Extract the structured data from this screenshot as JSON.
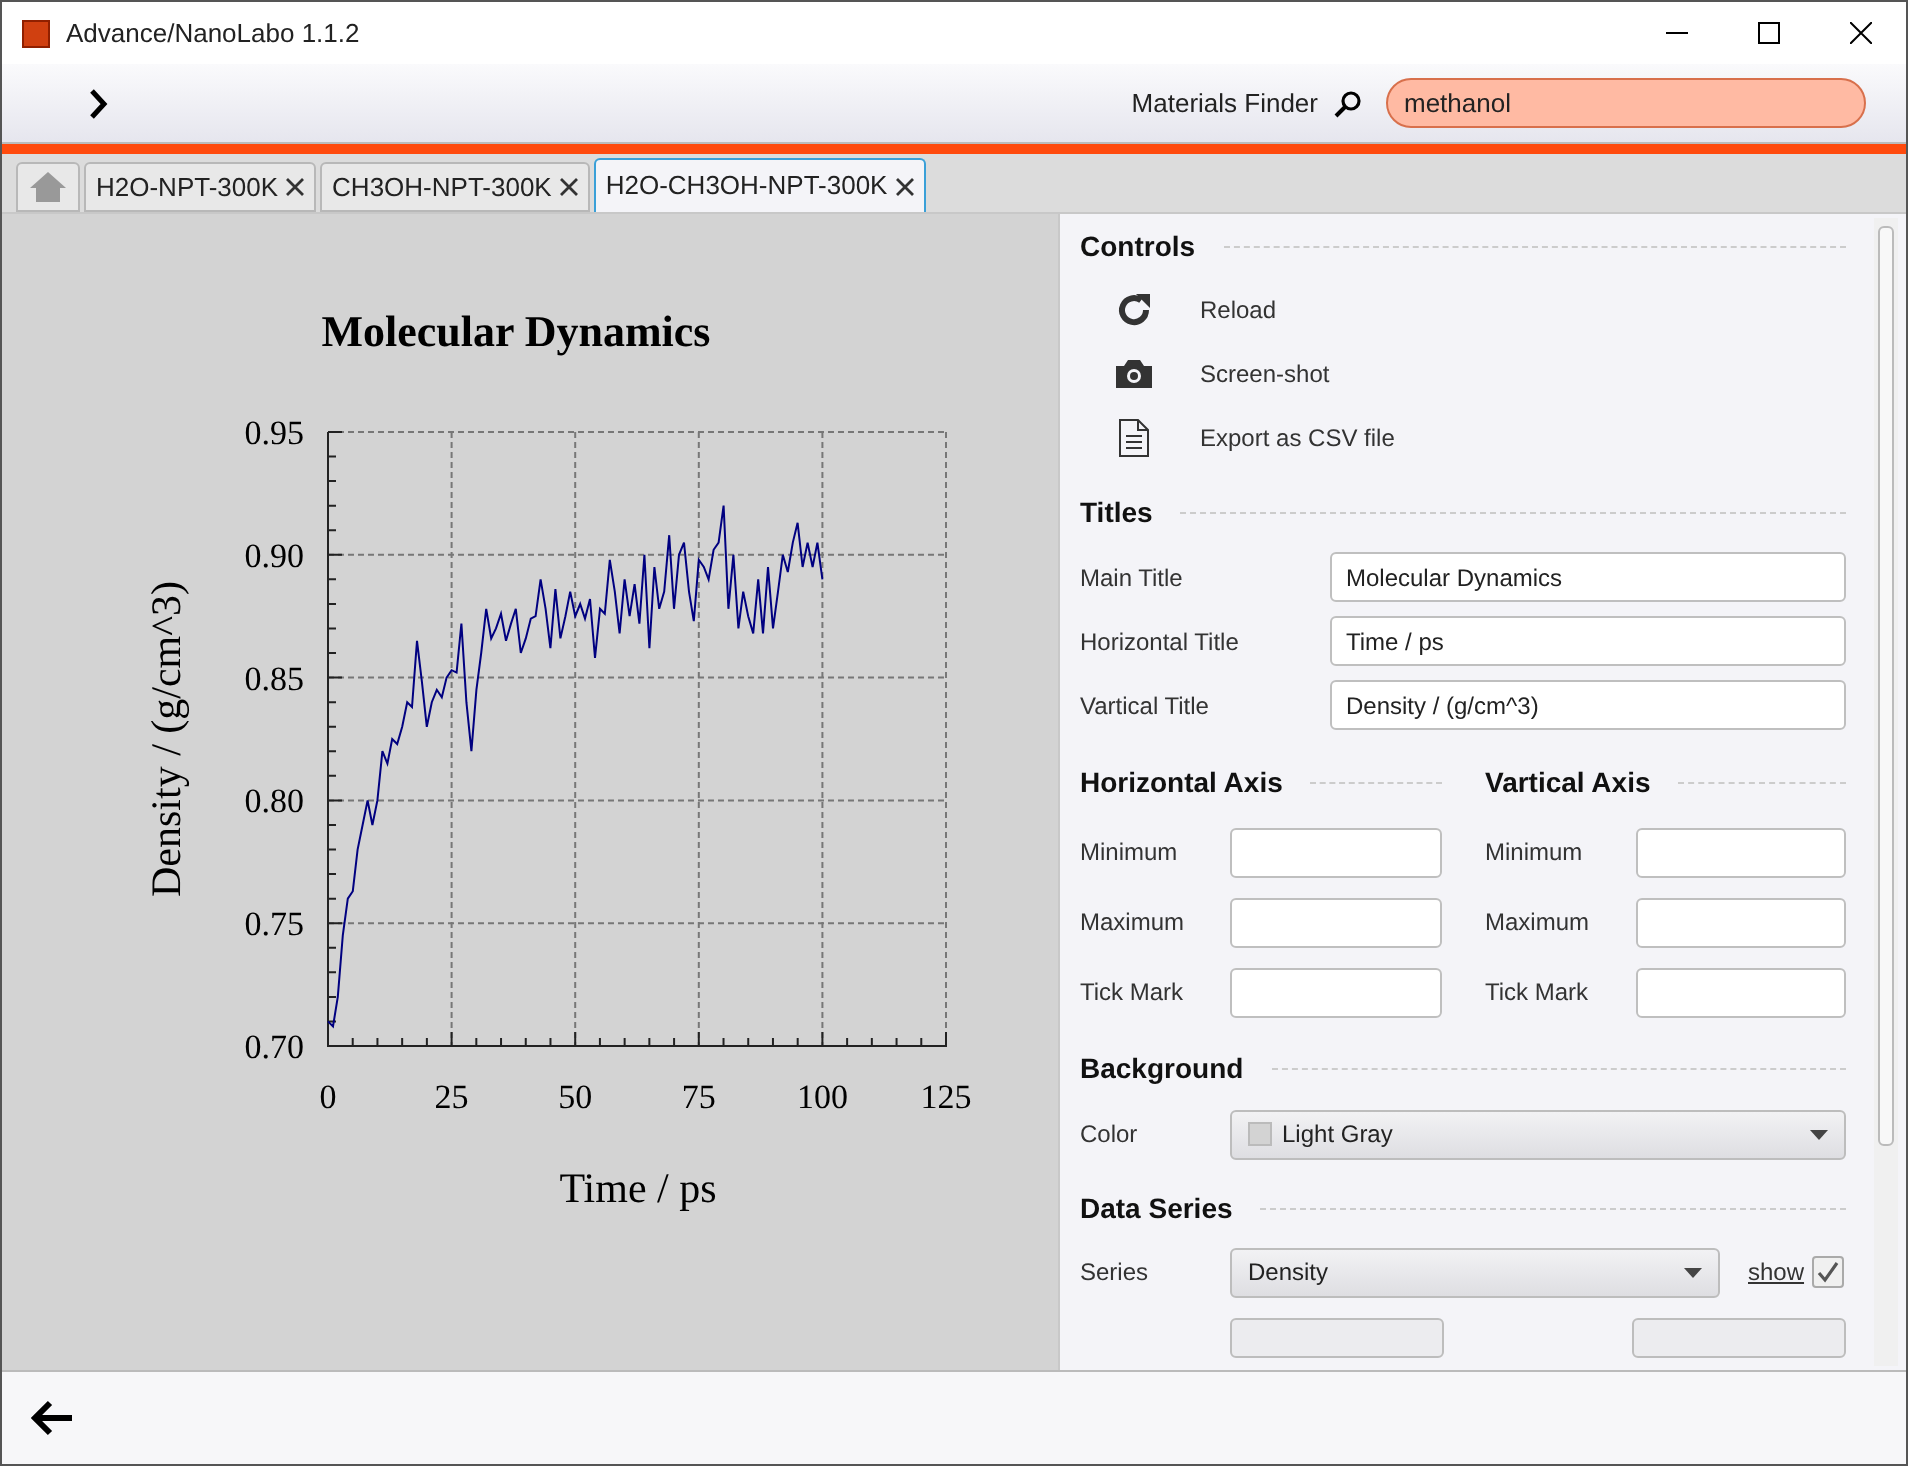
{
  "window": {
    "title": "Advance/NanoLabo 1.1.2"
  },
  "toolbar": {
    "finder_label": "Materials Finder",
    "search": {
      "value": "methanol"
    }
  },
  "tabs": [
    {
      "kind": "home",
      "selected": false
    },
    {
      "kind": "document",
      "label": "H2O-NPT-300K",
      "selected": false
    },
    {
      "kind": "document",
      "label": "CH3OH-NPT-300K",
      "selected": false
    },
    {
      "kind": "document",
      "label": "H2O-CH3OH-NPT-300K",
      "selected": true
    }
  ],
  "chart": {
    "chart_data": {
      "type": "line",
      "grid": true,
      "title": "Molecular Dynamics",
      "xlabel": "Time / ps",
      "ylabel": "Density / (g/cm^3)",
      "xlim": [
        0,
        125
      ],
      "ylim": [
        0.7,
        0.95
      ],
      "xticks": [
        0,
        25,
        50,
        75,
        100,
        125
      ],
      "yticks": [
        {
          "value": 0.7,
          "label": "0.70"
        },
        {
          "value": 0.75,
          "label": "0.75"
        },
        {
          "value": 0.8,
          "label": "0.80"
        },
        {
          "value": 0.85,
          "label": "0.85"
        },
        {
          "value": 0.9,
          "label": "0.90"
        },
        {
          "value": 0.95,
          "label": "0.95"
        }
      ],
      "x": [
        0,
        1,
        2,
        3,
        4,
        5,
        6,
        7,
        8,
        9,
        10,
        11,
        12,
        13,
        14,
        15,
        16,
        17,
        18,
        19,
        20,
        21,
        22,
        23,
        24,
        25,
        26,
        27,
        28,
        29,
        30,
        31,
        32,
        33,
        34,
        35,
        36,
        37,
        38,
        39,
        40,
        41,
        42,
        43,
        44,
        45,
        46,
        47,
        48,
        49,
        50,
        51,
        52,
        53,
        54,
        55,
        56,
        57,
        58,
        59,
        60,
        61,
        62,
        63,
        64,
        65,
        66,
        67,
        68,
        69,
        70,
        71,
        72,
        73,
        74,
        75,
        76,
        77,
        78,
        79,
        80,
        81,
        82,
        83,
        84,
        85,
        86,
        87,
        88,
        89,
        90,
        91,
        92,
        93,
        94,
        95,
        96,
        97,
        98,
        99,
        100
      ],
      "series": [
        {
          "color": "#000080",
          "values": [
            0.71,
            0.708,
            0.72,
            0.745,
            0.76,
            0.763,
            0.78,
            0.79,
            0.8,
            0.79,
            0.8,
            0.82,
            0.815,
            0.825,
            0.823,
            0.83,
            0.84,
            0.838,
            0.865,
            0.848,
            0.83,
            0.84,
            0.845,
            0.842,
            0.85,
            0.853,
            0.852,
            0.872,
            0.84,
            0.82,
            0.845,
            0.86,
            0.878,
            0.866,
            0.87,
            0.876,
            0.865,
            0.872,
            0.878,
            0.86,
            0.866,
            0.874,
            0.875,
            0.89,
            0.878,
            0.862,
            0.886,
            0.866,
            0.875,
            0.885,
            0.875,
            0.88,
            0.874,
            0.882,
            0.858,
            0.878,
            0.876,
            0.898,
            0.885,
            0.868,
            0.89,
            0.875,
            0.888,
            0.872,
            0.9,
            0.862,
            0.895,
            0.878,
            0.885,
            0.908,
            0.878,
            0.9,
            0.905,
            0.885,
            0.873,
            0.898,
            0.895,
            0.89,
            0.902,
            0.905,
            0.92,
            0.878,
            0.9,
            0.87,
            0.885,
            0.875,
            0.868,
            0.89,
            0.868,
            0.895,
            0.87,
            0.885,
            0.9,
            0.893,
            0.905,
            0.913,
            0.895,
            0.905,
            0.895,
            0.905,
            0.89
          ]
        }
      ]
    }
  },
  "panel": {
    "controls": {
      "title": "Controls",
      "actions": [
        {
          "kind": "reload",
          "label": "Reload"
        },
        {
          "kind": "camera",
          "label": "Screen-shot"
        },
        {
          "kind": "document",
          "label": "Export as CSV file"
        }
      ]
    },
    "titles": {
      "title": "Titles",
      "fields": [
        {
          "label": "Main Title",
          "value": "Molecular Dynamics"
        },
        {
          "label": "Horizontal Title",
          "value": "Time / ps"
        },
        {
          "label": "Vartical Title",
          "value": "Density / (g/cm^3)"
        }
      ]
    },
    "axes": [
      {
        "title": "Horizontal Axis",
        "fields": [
          {
            "label": "Minimum"
          },
          {
            "label": "Maximum"
          },
          {
            "label": "Tick Mark"
          }
        ]
      },
      {
        "title": "Vartical Axis",
        "fields": [
          {
            "label": "Minimum"
          },
          {
            "label": "Maximum"
          },
          {
            "label": "Tick Mark"
          }
        ]
      }
    ],
    "background": {
      "title": "Background",
      "label": "Color",
      "value": "Light Gray"
    },
    "data_series": {
      "title": "Data Series",
      "label": "Series",
      "value": "Density",
      "show": {
        "label": "show",
        "checked": true
      }
    }
  }
}
